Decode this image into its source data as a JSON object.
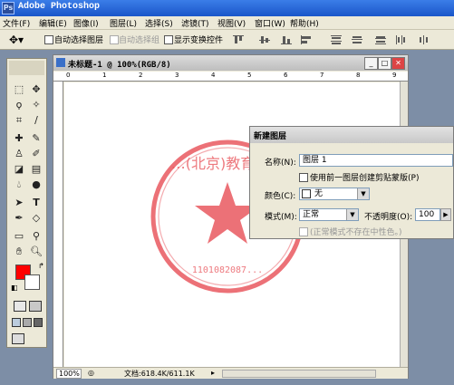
{
  "app": {
    "title": "Adobe Photoshop"
  },
  "menu": [
    "文件(F)",
    "编辑(E)",
    "图像(I)",
    "图层(L)",
    "选择(S)",
    "滤镜(T)",
    "视图(V)",
    "窗口(W)",
    "帮助(H)"
  ],
  "options": {
    "auto_select_layer": "自动选择图层",
    "auto_select_group": "自动选择组",
    "show_transform": "显示变换控件"
  },
  "document": {
    "title": "未标题-1 @ 100%(RGB/8)",
    "zoom": "100%",
    "doc_info": "文档:618.4K/611.1K",
    "ruler_marks": [
      "0",
      "1",
      "2",
      "3",
      "4",
      "5",
      "6",
      "7",
      "8",
      "9"
    ]
  },
  "seal": {
    "arc_text": "…(北京)教育咨…",
    "number": "1101082087...",
    "color": "#e9585f"
  },
  "dialog": {
    "title": "新建图层",
    "name_label": "名称(N):",
    "name_value": "图层 1",
    "clip_checkbox": "使用前一图层创建剪贴蒙版(P)",
    "color_label": "颜色(C):",
    "color_value": "无",
    "mode_label": "模式(M):",
    "mode_value": "正常",
    "opacity_label": "不透明度(O):",
    "opacity_value": "100",
    "note": "(正常模式不存在中性色。)"
  },
  "foreground_color": "#ff0000"
}
